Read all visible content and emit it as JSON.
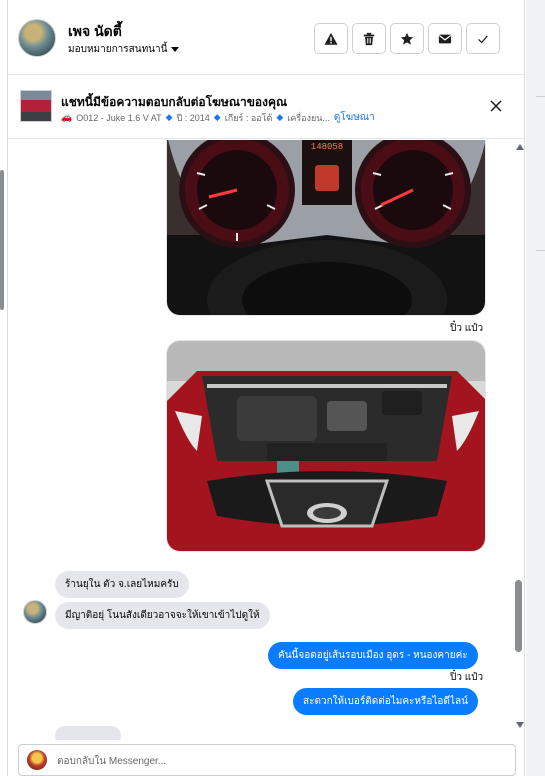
{
  "header": {
    "name": "เพจ นัดตี้",
    "assign_label": "มอบหมายการสนทนานี้",
    "actions": [
      "mark-spam",
      "delete",
      "star",
      "mark-unread",
      "done"
    ]
  },
  "ad": {
    "title": "แชทนี้มีข้อความตอบกลับต่อโฆษณาของคุณ",
    "car": "O012 - Juke 1.6 V AT",
    "year": "ปี : 2014",
    "gear": "เกียร์ : ออโต้",
    "engine": "เครื่องยน...",
    "view_ad": "ดูโฆษณา"
  },
  "thread": {
    "seen_1": "ปิ๋ว แป๋ว",
    "msg_in_1": "ร้านยุใน ตัว จ.เลยไหมครับ",
    "msg_in_2": "มีญาติอยุ่ โนนสังเดียวอาจจะให้เขาเข้าไปดูให้",
    "msg_out_1": "คันนี้จอดอยู่เส้นรอบเมือง อุดร - หนองคายค่ะ",
    "seen_2": "ปิ๋ว แป๋ว",
    "msg_out_2": "สะดวกให้เบอร์ติดต่อไมคะหรือไอดีไลน์"
  },
  "dash": {
    "odometer": "148058"
  },
  "composer": {
    "placeholder": "ตอบกลับใน Messenger..."
  },
  "colors": {
    "accent": "#0a7cff",
    "link": "#1877f2",
    "bubble_in": "#e4e6eb"
  }
}
